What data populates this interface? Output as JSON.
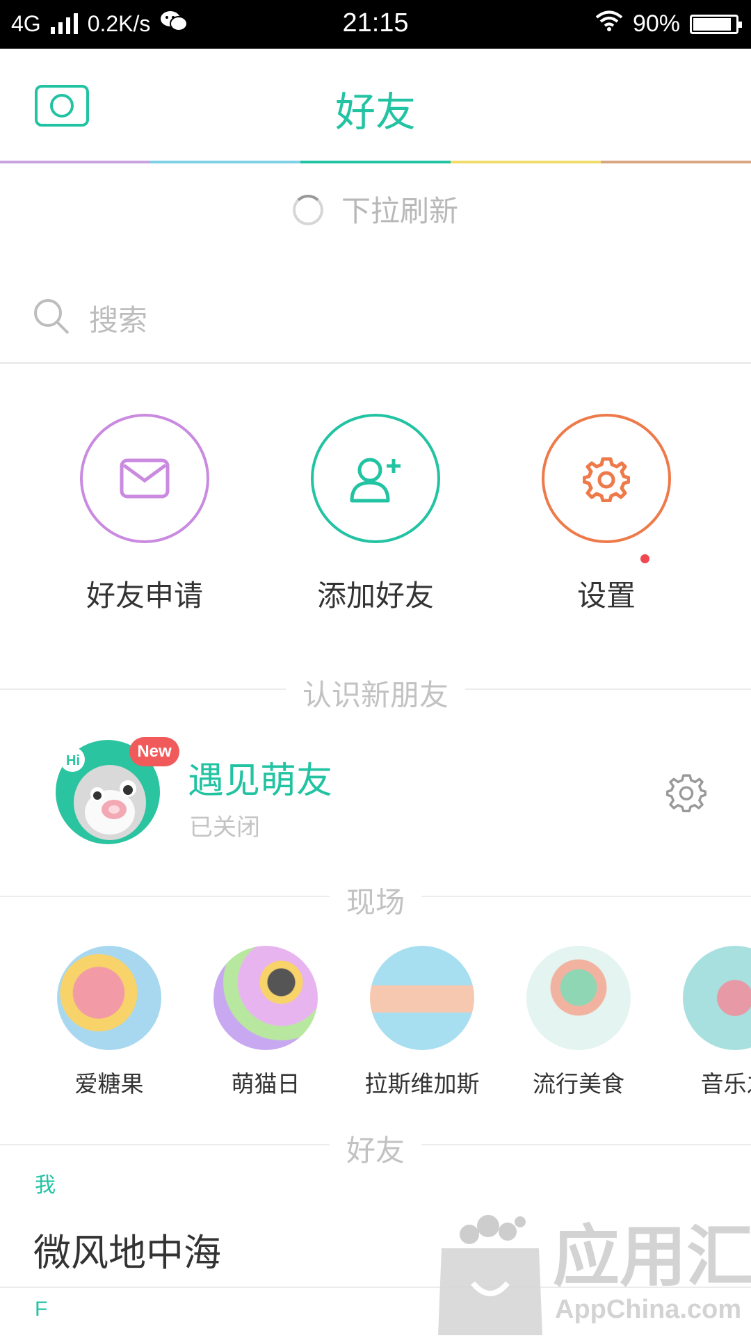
{
  "status_bar": {
    "network": "4G",
    "speed": "0.2K/s",
    "time": "21:15",
    "battery": "90%"
  },
  "header": {
    "title": "好友",
    "rainbow_colors": [
      "#c9a2e0",
      "#7fd0e6",
      "#22c3a2",
      "#f0dc6a",
      "#d9a684"
    ]
  },
  "refresh": {
    "text": "下拉刷新"
  },
  "search": {
    "placeholder": "搜索"
  },
  "actions": [
    {
      "label": "好友申请",
      "icon": "mail-icon",
      "color": "#c98ae0"
    },
    {
      "label": "添加好友",
      "icon": "add-user-icon",
      "color": "#22c3a2"
    },
    {
      "label": "设置",
      "icon": "gear-icon",
      "color": "#ee7a4a",
      "has_dot": true
    }
  ],
  "sections": {
    "meet_new": "认识新朋友",
    "live": "现场",
    "friends": "好友"
  },
  "meet": {
    "badge": "New",
    "title": "遇见萌友",
    "status": "已关闭"
  },
  "scenes": [
    {
      "label": "爱糖果",
      "color": "#a8d8f0"
    },
    {
      "label": "萌猫日",
      "color": "#d8b4f0"
    },
    {
      "label": "拉斯维加斯",
      "color": "#a8dff0"
    },
    {
      "label": "流行美食",
      "color": "#e4f4f0"
    },
    {
      "label": "音乐之",
      "color": "#a8e0e0"
    }
  ],
  "friends": {
    "groups": [
      {
        "letter": "我",
        "names": [
          "微风地中海"
        ]
      },
      {
        "letter": "F",
        "names": []
      }
    ]
  },
  "watermark": {
    "text": "应用汇",
    "sub": "AppChina.com"
  }
}
